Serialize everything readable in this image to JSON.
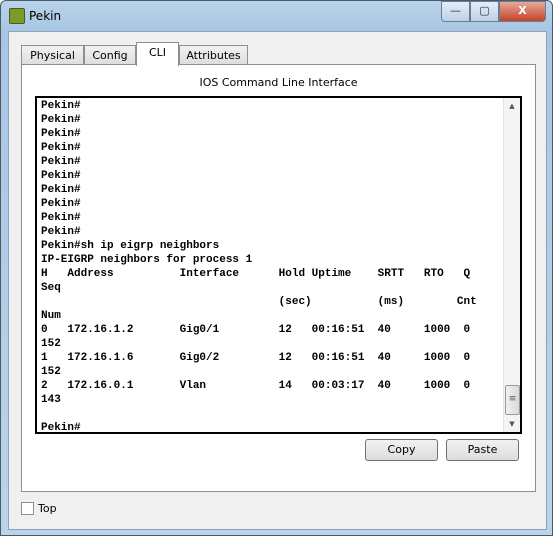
{
  "window": {
    "title": "Pekin",
    "minimize": "—",
    "maximize": "▢",
    "close": "X"
  },
  "tabs": [
    {
      "label": "Physical"
    },
    {
      "label": "Config"
    },
    {
      "label": "CLI",
      "active": true
    },
    {
      "label": "Attributes"
    }
  ],
  "cli": {
    "heading": "IOS Command Line Interface",
    "lines": [
      "Pekin#",
      "Pekin#",
      "Pekin#",
      "Pekin#",
      "Pekin#",
      "Pekin#",
      "Pekin#",
      "Pekin#",
      "Pekin#",
      "Pekin#",
      "Pekin#sh ip eigrp neighbors",
      "IP-EIGRP neighbors for process 1",
      "H   Address          Interface      Hold Uptime    SRTT   RTO   Q",
      "Seq",
      "                                    (sec)          (ms)        Cnt",
      "Num",
      "0   172.16.1.2       Gig0/1         12   00:16:51  40     1000  0",
      "152",
      "1   172.16.1.6       Gig0/2         12   00:16:51  40     1000  0",
      "152",
      "2   172.16.0.1       Vlan           14   00:03:17  40     1000  0",
      "143",
      "",
      "Pekin#"
    ]
  },
  "buttons": {
    "copy": "Copy",
    "paste": "Paste"
  },
  "top_checkbox": {
    "label": "Top",
    "checked": false
  }
}
